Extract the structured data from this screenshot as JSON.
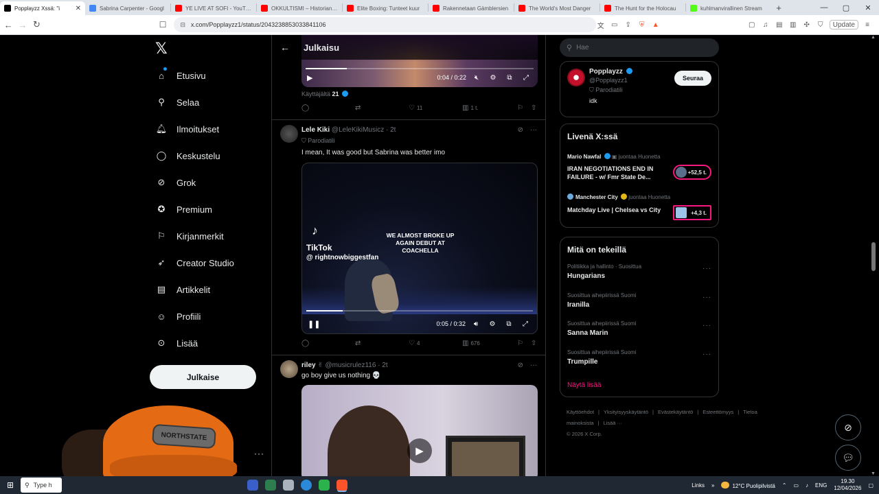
{
  "browser": {
    "tabs": [
      {
        "title": "Popplayzz Xssä: \"i",
        "favicon_color": "#000000",
        "active": true
      },
      {
        "title": "Sabrina Carpenter - Googl",
        "favicon_color": "#4285f4",
        "active": false
      },
      {
        "title": "YE LIVE AT SOFI - YouTube",
        "favicon_color": "#ff0000",
        "active": false
      },
      {
        "title": "OKKULTISMI – Historian hy",
        "favicon_color": "#ff0000",
        "active": false
      },
      {
        "title": "Elite Boxing: Tunteet kuur",
        "favicon_color": "#ff0000",
        "active": false
      },
      {
        "title": "Rakennetaan Gämblersien",
        "favicon_color": "#ff0000",
        "active": false
      },
      {
        "title": "The World's Most Danger",
        "favicon_color": "#ff0000",
        "active": false
      },
      {
        "title": "The Hunt for the Holocau",
        "favicon_color": "#ff0000",
        "active": false
      },
      {
        "title": "kuhlmanvirallinen Stream",
        "favicon_color": "#53fc18",
        "active": false
      }
    ],
    "url": "x.com/Popplayzz1/status/2043238853033841106",
    "update_label": "Update"
  },
  "nav": {
    "items": [
      {
        "label": "Etusivu",
        "icon": "home-icon"
      },
      {
        "label": "Selaa",
        "icon": "search-icon"
      },
      {
        "label": "Ilmoitukset",
        "icon": "bell-icon"
      },
      {
        "label": "Keskustelu",
        "icon": "chat-icon"
      },
      {
        "label": "Grok",
        "icon": "grok-icon"
      },
      {
        "label": "Premium",
        "icon": "verified-icon"
      },
      {
        "label": "Kirjanmerkit",
        "icon": "bookmark-icon"
      },
      {
        "label": "Creator Studio",
        "icon": "rocket-icon"
      },
      {
        "label": "Artikkelit",
        "icon": "article-icon"
      },
      {
        "label": "Profiili",
        "icon": "person-icon"
      },
      {
        "label": "Lisää",
        "icon": "more-circle-icon"
      }
    ],
    "post_label": "Julkaise"
  },
  "center": {
    "header_title": "Julkaisu",
    "top_video": {
      "time": "0:04 / 0:22",
      "progress": 0.18
    },
    "byline_prefix": "Käyttäjältä",
    "byline_user": "21",
    "top_actions": {
      "replies": "",
      "reposts": "",
      "likes": "11",
      "views": "1 t."
    },
    "post1": {
      "name": "Lele Kiki",
      "handle": "@LeleKikiMusicz",
      "time": "· 2t",
      "parody": "Parodiatili",
      "text": "I mean, It was good but Sabrina was better imo",
      "video": {
        "tiktok": "TikTok",
        "tiktok_handle": "@ rightnowbiggestfan",
        "caption": "WE ALMOST BROKE UP AGAIN DEBUT AT COACHELLA",
        "time": "0:05 / 0:32",
        "progress": 0.16
      },
      "actions": {
        "likes": "4",
        "views": "676"
      }
    },
    "post2": {
      "name": "riley",
      "emoji": "✌",
      "handle": "@musicrulez116",
      "time": "· 2t",
      "text": "go boy give us nothing 💀"
    }
  },
  "right": {
    "search_placeholder": "Hae",
    "profile": {
      "name": "Popplayzz",
      "handle": "@Popplayzz1",
      "parody": "Parodiatili",
      "bio": "idk",
      "follow_label": "Seuraa"
    },
    "live": {
      "title": "Livenä X:ssä",
      "items": [
        {
          "host": "Mario Nawfal",
          "role": "juontaa Huonetta",
          "title": "IRAN NEGOTIATIONS END IN FAILURE - w/ Fmr State De...",
          "count": "+52,5 t."
        },
        {
          "host": "Manchester City",
          "role": "juontaa Huonetta",
          "title": "Matchday Live | Chelsea vs City",
          "count": "+4,3 t."
        }
      ]
    },
    "trends": {
      "title": "Mitä on tekeillä",
      "items": [
        {
          "category": "Politiikka ja hallinto · Suosittua",
          "name": "Hungarians"
        },
        {
          "category": "Suosittua aihepiirissä Suomi",
          "name": "Iranilla"
        },
        {
          "category": "Suosittua aihepiirissä Suomi",
          "name": "Sanna Marin"
        },
        {
          "category": "Suosittua aihepiirissä Suomi",
          "name": "Trumpille"
        }
      ],
      "show_more": "Näytä lisää"
    },
    "footer": {
      "links": [
        "Käyttöehdot",
        "|",
        "Yksityisyyskäytäntö",
        "|",
        "Evästekäytäntö",
        "|",
        "Esteettömyys",
        "|",
        "Tietoa mainoksista",
        "|",
        "Lisää ···"
      ],
      "copyright": "© 2026 X Corp."
    }
  },
  "webcam": {
    "cap_text": "NORTHSTATE"
  },
  "taskbar": {
    "search_text": "Type h",
    "links": "Links",
    "weather": "12°C  Puolipilvistä",
    "lang": "ENG",
    "time": "19.30",
    "date": "12/04/2026"
  }
}
